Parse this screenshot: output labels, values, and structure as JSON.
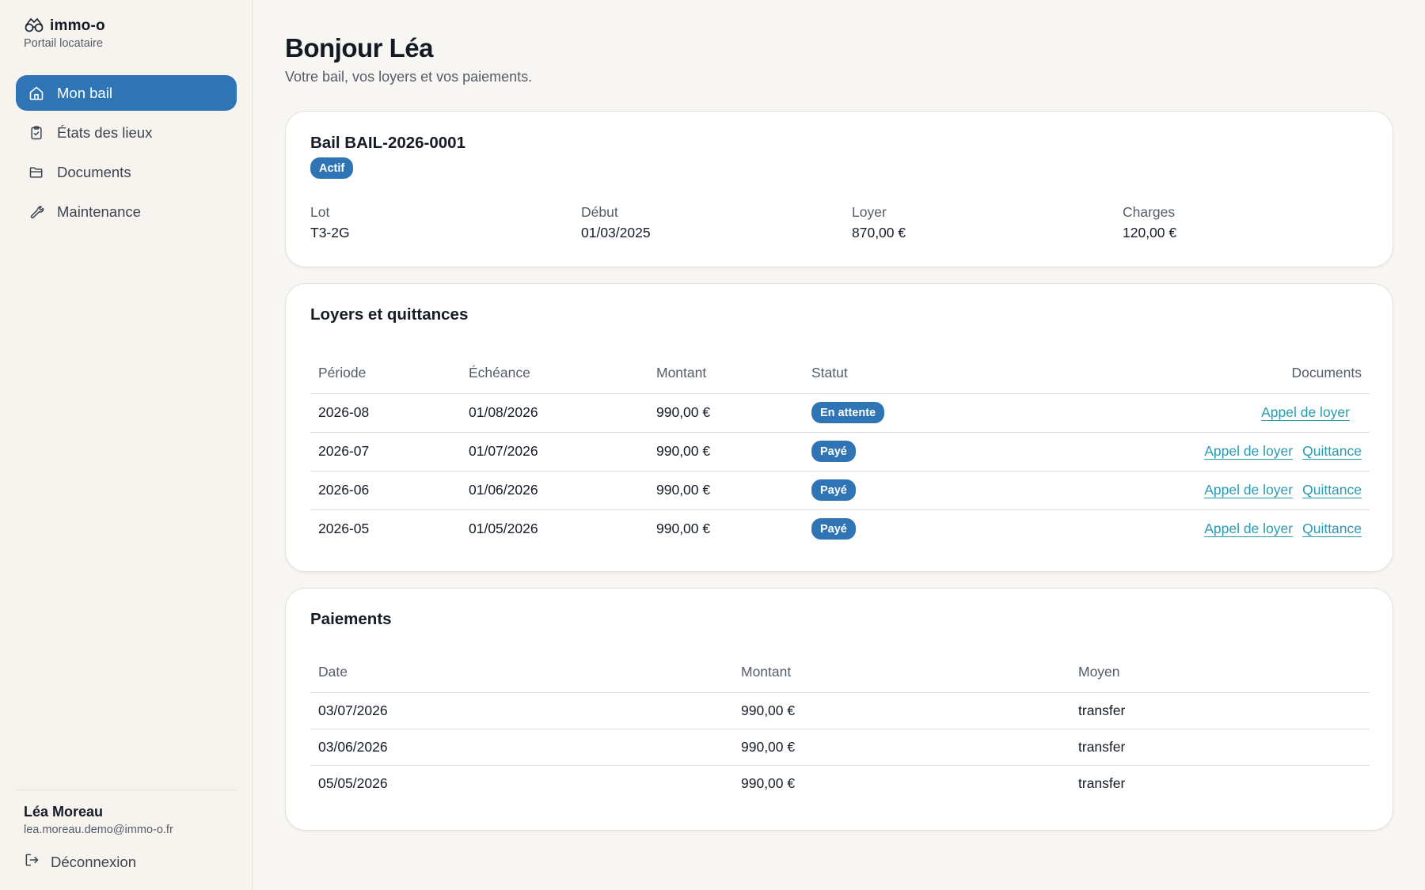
{
  "brand": {
    "name": "immo-o",
    "subtitle": "Portail locataire"
  },
  "nav": {
    "items": [
      {
        "label": "Mon bail",
        "icon": "home-icon",
        "active": true
      },
      {
        "label": "États des lieux",
        "icon": "clipboard-icon",
        "active": false
      },
      {
        "label": "Documents",
        "icon": "folder-icon",
        "active": false
      },
      {
        "label": "Maintenance",
        "icon": "wrench-icon",
        "active": false
      }
    ]
  },
  "user": {
    "name": "Léa Moreau",
    "email": "lea.moreau.demo@immo-o.fr",
    "logout_label": "Déconnexion"
  },
  "page": {
    "title": "Bonjour Léa",
    "subtitle": "Votre bail, vos loyers et vos paiements."
  },
  "lease": {
    "title": "Bail BAIL-2026-0001",
    "status": "Actif",
    "fields": [
      {
        "label": "Lot",
        "value": "T3-2G"
      },
      {
        "label": "Début",
        "value": "01/03/2025"
      },
      {
        "label": "Loyer",
        "value": "870,00 €"
      },
      {
        "label": "Charges",
        "value": "120,00 €"
      }
    ]
  },
  "rents": {
    "title": "Loyers et quittances",
    "columns": [
      "Période",
      "Échéance",
      "Montant",
      "Statut",
      "Documents"
    ],
    "rows": [
      {
        "period": "2026-08",
        "due": "01/08/2026",
        "amount": "990,00 €",
        "status": "En attente",
        "docs": [
          "Appel de loyer"
        ]
      },
      {
        "period": "2026-07",
        "due": "01/07/2026",
        "amount": "990,00 €",
        "status": "Payé",
        "docs": [
          "Appel de loyer",
          "Quittance"
        ]
      },
      {
        "period": "2026-06",
        "due": "01/06/2026",
        "amount": "990,00 €",
        "status": "Payé",
        "docs": [
          "Appel de loyer",
          "Quittance"
        ]
      },
      {
        "period": "2026-05",
        "due": "01/05/2026",
        "amount": "990,00 €",
        "status": "Payé",
        "docs": [
          "Appel de loyer",
          "Quittance"
        ]
      }
    ]
  },
  "payments": {
    "title": "Paiements",
    "columns": [
      "Date",
      "Montant",
      "Moyen"
    ],
    "rows": [
      {
        "date": "03/07/2026",
        "amount": "990,00 €",
        "method": "transfer"
      },
      {
        "date": "03/06/2026",
        "amount": "990,00 €",
        "method": "transfer"
      },
      {
        "date": "05/05/2026",
        "amount": "990,00 €",
        "method": "transfer"
      }
    ]
  },
  "colors": {
    "accent": "#2f75b5",
    "link": "#2a9ab0",
    "background": "#f8f6f3",
    "card": "#ffffff"
  }
}
